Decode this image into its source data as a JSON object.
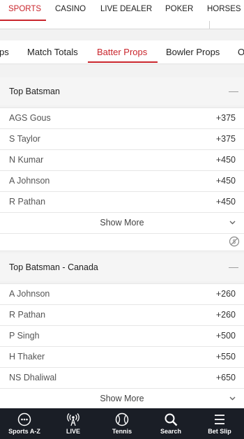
{
  "top_nav": {
    "items": [
      "SPORTS",
      "CASINO",
      "LIVE DEALER",
      "POKER",
      "HORSES"
    ],
    "active": "SPORTS"
  },
  "sub_tabs": {
    "items": [
      "ps",
      "Match Totals",
      "Batter Props",
      "Bowler Props",
      "O"
    ],
    "active": "Batter Props"
  },
  "sections": [
    {
      "title": "Top Batsman",
      "rows": [
        {
          "name": "AGS Gous",
          "odds": "+375"
        },
        {
          "name": "S Taylor",
          "odds": "+375"
        },
        {
          "name": "N Kumar",
          "odds": "+450"
        },
        {
          "name": "A Johnson",
          "odds": "+450"
        },
        {
          "name": "R Pathan",
          "odds": "+450"
        }
      ],
      "show_more": "Show More"
    },
    {
      "title": "Top Batsman - Canada",
      "rows": [
        {
          "name": "A Johnson",
          "odds": "+260"
        },
        {
          "name": "R Pathan",
          "odds": "+260"
        },
        {
          "name": "P Singh",
          "odds": "+500"
        },
        {
          "name": "H Thaker",
          "odds": "+550"
        },
        {
          "name": "NS Dhaliwal",
          "odds": "+650"
        }
      ],
      "show_more": "Show More"
    }
  ],
  "bottom_nav": [
    {
      "label": "Sports A-Z",
      "icon": "grid-dots-icon"
    },
    {
      "label": "LIVE",
      "icon": "broadcast-icon"
    },
    {
      "label": "Tennis",
      "icon": "tennis-ball-icon"
    },
    {
      "label": "Search",
      "icon": "search-icon"
    },
    {
      "label": "Bet Slip",
      "icon": "menu-icon"
    }
  ],
  "colors": {
    "accent": "#c9252c",
    "bottom_bar": "#1a1e26"
  }
}
